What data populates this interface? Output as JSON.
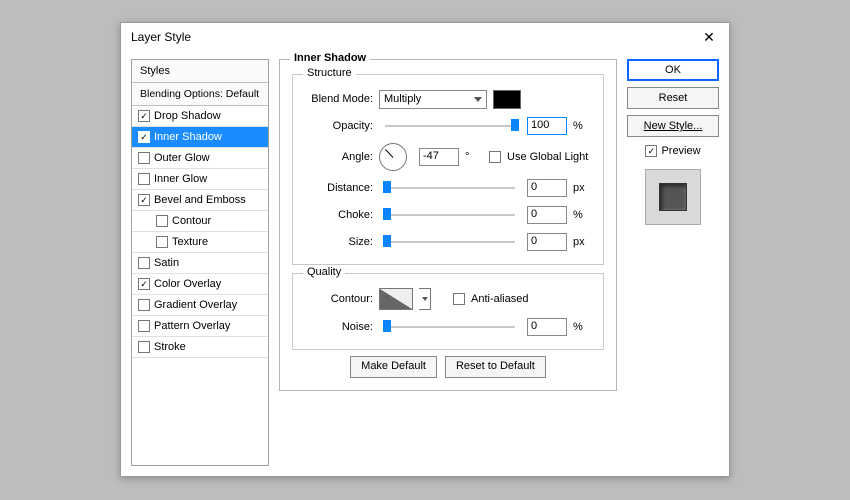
{
  "window": {
    "title": "Layer Style"
  },
  "sidebar": {
    "header": "Styles",
    "blending": "Blending Options: Default",
    "items": [
      {
        "label": "Drop Shadow",
        "checked": true,
        "selected": false,
        "indent": false
      },
      {
        "label": "Inner Shadow",
        "checked": true,
        "selected": true,
        "indent": false
      },
      {
        "label": "Outer Glow",
        "checked": false,
        "selected": false,
        "indent": false
      },
      {
        "label": "Inner Glow",
        "checked": false,
        "selected": false,
        "indent": false
      },
      {
        "label": "Bevel and Emboss",
        "checked": true,
        "selected": false,
        "indent": false
      },
      {
        "label": "Contour",
        "checked": false,
        "selected": false,
        "indent": true
      },
      {
        "label": "Texture",
        "checked": false,
        "selected": false,
        "indent": true
      },
      {
        "label": "Satin",
        "checked": false,
        "selected": false,
        "indent": false
      },
      {
        "label": "Color Overlay",
        "checked": true,
        "selected": false,
        "indent": false
      },
      {
        "label": "Gradient Overlay",
        "checked": false,
        "selected": false,
        "indent": false
      },
      {
        "label": "Pattern Overlay",
        "checked": false,
        "selected": false,
        "indent": false
      },
      {
        "label": "Stroke",
        "checked": false,
        "selected": false,
        "indent": false
      }
    ]
  },
  "panel": {
    "title": "Inner Shadow",
    "structure": {
      "title": "Structure",
      "blend_mode_label": "Blend Mode:",
      "blend_mode_value": "Multiply",
      "opacity_label": "Opacity:",
      "opacity_value": "100",
      "opacity_unit": "%",
      "angle_label": "Angle:",
      "angle_value": "-47",
      "angle_unit": "°",
      "use_global_label": "Use Global Light",
      "distance_label": "Distance:",
      "distance_value": "0",
      "distance_unit": "px",
      "choke_label": "Choke:",
      "choke_value": "0",
      "choke_unit": "%",
      "size_label": "Size:",
      "size_value": "0",
      "size_unit": "px"
    },
    "quality": {
      "title": "Quality",
      "contour_label": "Contour:",
      "antialiased_label": "Anti-aliased",
      "noise_label": "Noise:",
      "noise_value": "0",
      "noise_unit": "%"
    },
    "buttons": {
      "make_default": "Make Default",
      "reset_default": "Reset to Default"
    }
  },
  "right": {
    "ok": "OK",
    "reset": "Reset",
    "new_style": "New Style...",
    "preview": "Preview"
  }
}
